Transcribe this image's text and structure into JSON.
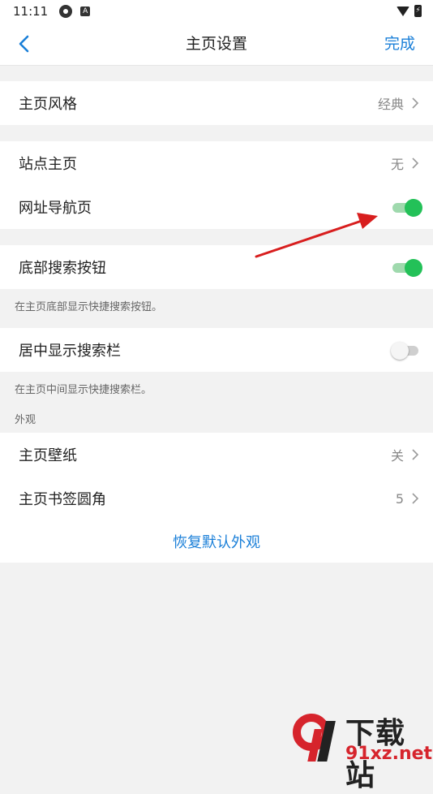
{
  "status_bar": {
    "time": "11:11",
    "gear_icon": "gear-icon",
    "a_icon": "A"
  },
  "nav": {
    "title": "主页设置",
    "done": "完成",
    "back_icon": "chevron-left-icon"
  },
  "groups": {
    "style": {
      "label": "主页风格",
      "value": "经典"
    },
    "site": {
      "label": "站点主页",
      "value": "无"
    },
    "url_nav": {
      "label": "网址导航页",
      "enabled": true
    },
    "bottom_search": {
      "label": "底部搜索按钮",
      "enabled": true,
      "hint": "在主页底部显示快捷搜索按钮。"
    },
    "center_search": {
      "label": "居中显示搜索栏",
      "enabled": false,
      "hint": "在主页中间显示快捷搜索栏。"
    }
  },
  "appearance": {
    "section_title": "外观",
    "wallpaper": {
      "label": "主页壁纸",
      "value": "关"
    },
    "bookmark_radius": {
      "label": "主页书签圆角",
      "value": "5"
    },
    "restore": "恢复默认外观"
  },
  "watermark": {
    "top": "下载站",
    "bottom": "91xz.net",
    "logo": "9f"
  },
  "colors": {
    "accent": "#1a7fd8",
    "toggle_on": "#23c158",
    "annotation": "#d81e1e"
  }
}
